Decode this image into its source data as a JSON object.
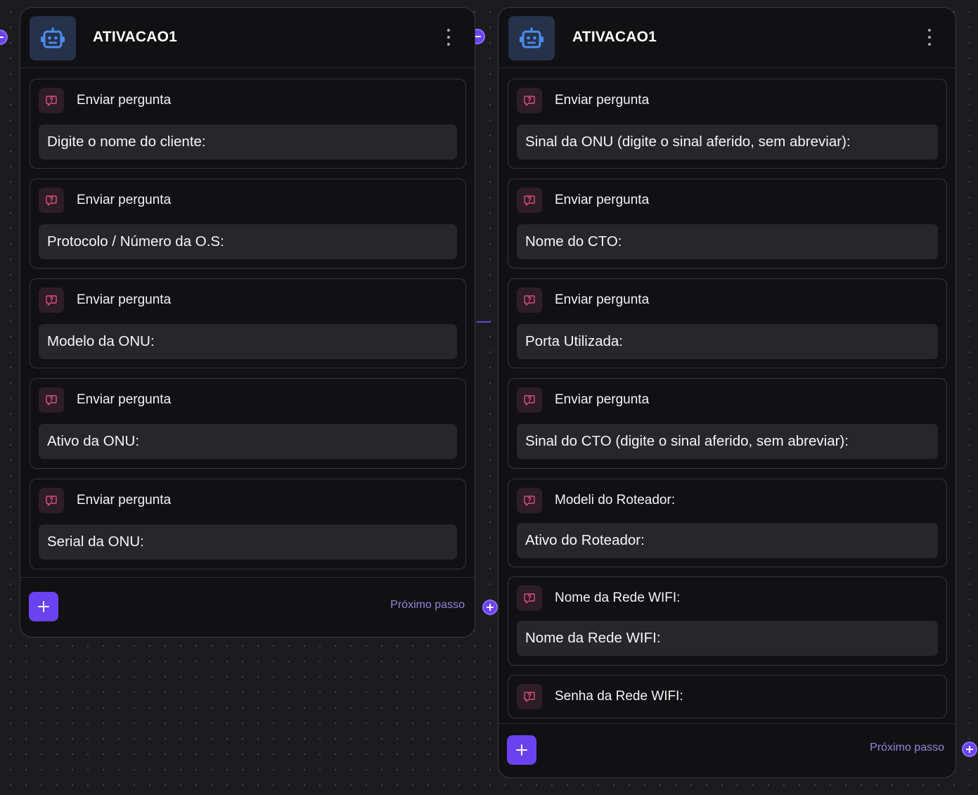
{
  "colors": {
    "canvas": "#1c1c1f",
    "node_bg": "#111114",
    "accent": "#6a43f0",
    "icon_tile": "#26324a",
    "question_icon": "#e0507a",
    "next_step_text": "#8f86d8"
  },
  "nodes": [
    {
      "title": "ATIVACAO1",
      "icon": "robot-icon",
      "cards": [
        {
          "label": "Enviar pergunta",
          "text": "Digite o nome do cliente:",
          "icon": "question-chat-icon"
        },
        {
          "label": "Enviar pergunta",
          "text": "Protocolo / Número da O.S:",
          "icon": "question-chat-icon"
        },
        {
          "label": "Enviar pergunta",
          "text": "Modelo da ONU:",
          "icon": "question-chat-icon"
        },
        {
          "label": "Enviar pergunta",
          "text": "Ativo da ONU:",
          "icon": "question-chat-icon"
        },
        {
          "label": "Enviar pergunta",
          "text": "Serial da ONU:",
          "icon": "question-chat-icon"
        }
      ],
      "add_button_label": "+",
      "next_step_label": "Próximo passo"
    },
    {
      "title": "ATIVACAO1",
      "icon": "robot-icon",
      "cards": [
        {
          "label": "Enviar pergunta",
          "text": "Sinal da ONU (digite o sinal aferido, sem abreviar):",
          "icon": "question-chat-icon"
        },
        {
          "label": "Enviar pergunta",
          "text": "Nome do CTO:",
          "icon": "question-chat-icon"
        },
        {
          "label": "Enviar pergunta",
          "text": "Porta Utilizada:",
          "icon": "question-chat-icon"
        },
        {
          "label": "Enviar pergunta",
          "text": "Sinal do CTO (digite o sinal aferido, sem abreviar):",
          "icon": "question-chat-icon"
        },
        {
          "label": "Modeli do Roteador:",
          "text": "Ativo do Roteador:",
          "icon": "question-chat-icon"
        },
        {
          "label": "Nome da Rede WIFI:",
          "text": "Nome da Rede WIFI:",
          "icon": "question-chat-icon"
        },
        {
          "label": "Senha da Rede WIFI:",
          "icon": "question-chat-icon"
        }
      ],
      "add_button_label": "+",
      "next_step_label": "Próximo passo"
    }
  ]
}
